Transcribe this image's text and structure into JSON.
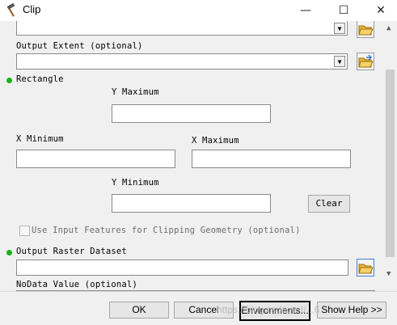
{
  "window": {
    "title": "Clip",
    "minimize_glyph": "—",
    "maximize_glyph": "☐",
    "close_glyph": "✕"
  },
  "form": {
    "output_extent_label": "Output Extent (optional)",
    "rectangle_label": "Rectangle",
    "y_maximum_label": "Y Maximum",
    "x_minimum_label": "X Minimum",
    "x_maximum_label": "X Maximum",
    "y_minimum_label": "Y Minimum",
    "clear_label": "Clear",
    "use_input_features_label": "Use Input Features for Clipping Geometry (optional)",
    "output_raster_label": "Output Raster Dataset",
    "nodata_label": "NoData Value (optional)"
  },
  "buttons": {
    "ok": "OK",
    "cancel": "Cancel",
    "environments": "Environments...",
    "show_help": "Show Help >>"
  },
  "watermark": "https://blog.csdn.net/...6",
  "icons": {
    "app": "hammer-icon",
    "folder": "folder-open-icon",
    "dropdown": "chevron-down-icon"
  },
  "colors": {
    "required_dot": "#19b21b",
    "focus_border": "#000000"
  }
}
